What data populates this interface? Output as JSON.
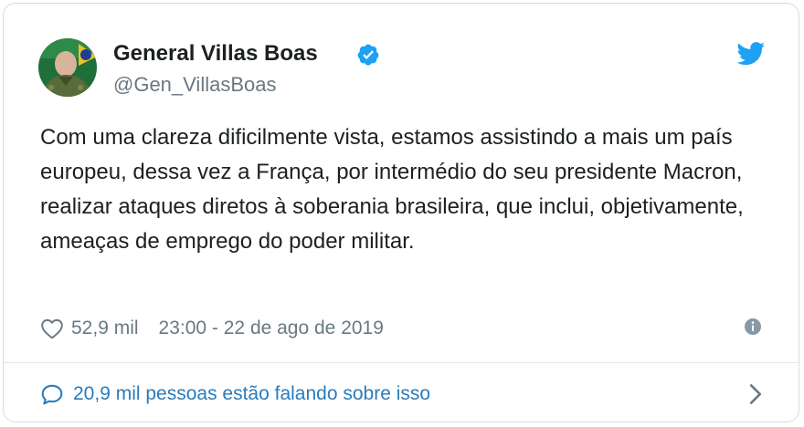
{
  "author": {
    "name": "General Villas Boas",
    "handle": "@Gen_VillasBoas"
  },
  "icons": {
    "verified": "verified-badge-icon",
    "platform": "twitter-bird-icon",
    "like": "heart-icon",
    "info": "info-icon",
    "reply": "speech-bubble-icon",
    "more": "chevron-right-icon"
  },
  "tweet": {
    "text": "Com uma clareza dificilmente vista, estamos assistindo a mais um país europeu, dessa vez a França, por intermédio do seu presidente Macron, realizar ataques diretos à soberania brasileira, que inclui, objetivamente, ameaças de emprego do poder militar.",
    "likes": "52,9 mil",
    "timestamp": "23:00 - 22 de ago de 2019"
  },
  "footer": {
    "conversation": "20,9 mil pessoas estão falando sobre isso"
  },
  "colors": {
    "brand_blue": "#1da1f2",
    "link_blue": "#2b7bb9",
    "text": "#1c2022",
    "muted": "#697882",
    "border": "#d5dde3"
  }
}
